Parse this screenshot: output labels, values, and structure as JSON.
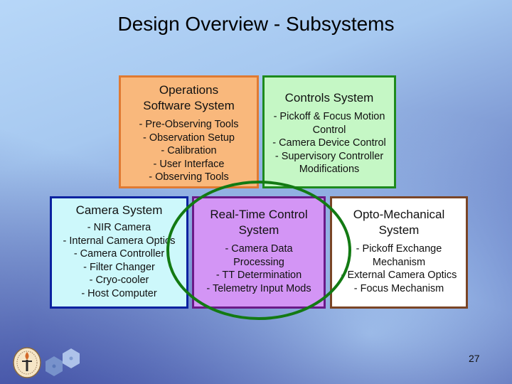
{
  "slide": {
    "title": "Design Overview - Subsystems",
    "page_number": "27"
  },
  "boxes": {
    "operations": {
      "heading": "Operations Software System",
      "items": [
        "- Pre-Observing Tools",
        "- Observation Setup",
        "- Calibration",
        "- User Interface",
        "- Observing Tools"
      ],
      "fill": "#f9b87c",
      "border": "#e07a32"
    },
    "controls": {
      "heading": "Controls System",
      "items": [
        "- Pickoff & Focus Motion Control",
        "- Camera Device Control",
        "- Supervisory Controller Modifications"
      ],
      "fill": "#c5f7c5",
      "border": "#1d8a1d"
    },
    "camera": {
      "heading": "Camera System",
      "items": [
        "- NIR Camera",
        "- Internal Camera Optics",
        "- Camera Controller",
        "- Filter Changer",
        "- Cryo-cooler",
        "- Host Computer"
      ],
      "fill": "#cdf8fb",
      "border": "#0a22a0"
    },
    "realtime": {
      "heading": "Real-Time Control System",
      "items": [
        "- Camera Data Processing",
        "- TT Determination",
        "- Telemetry Input Mods"
      ],
      "fill": "#d395f5",
      "border": "#6a1a88"
    },
    "optomech": {
      "heading": "Opto-Mechanical System",
      "items": [
        "- Pickoff Exchange Mechanism",
        "- External Camera Optics",
        "- Focus Mechanism"
      ],
      "fill": "#ffffff",
      "border": "#7a4526"
    }
  },
  "highlight": {
    "shape": "ellipse",
    "color": "#1a7a1a",
    "target": "Real-Time Control System"
  },
  "logos": [
    "university-seal-logo",
    "hexagonal-mirror-logo"
  ]
}
